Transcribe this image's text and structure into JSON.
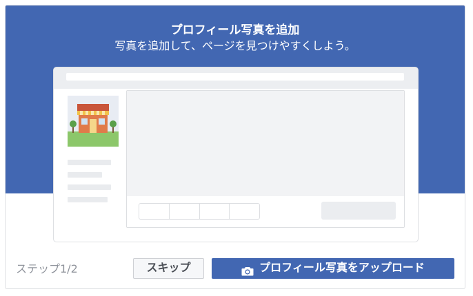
{
  "dialog": {
    "title": "プロフィール写真を追加",
    "subtitle": "写真を追加して、ページを見つけやすくしよう。"
  },
  "footer": {
    "step_text": "ステップ1/2",
    "skip_label": "スキップ",
    "upload_label": "プロフィール写真をアップロード",
    "upload_icon": "camera-icon"
  },
  "colors": {
    "brand_blue": "#4267b2",
    "muted_text": "#90949c",
    "border": "#dddfe2"
  }
}
